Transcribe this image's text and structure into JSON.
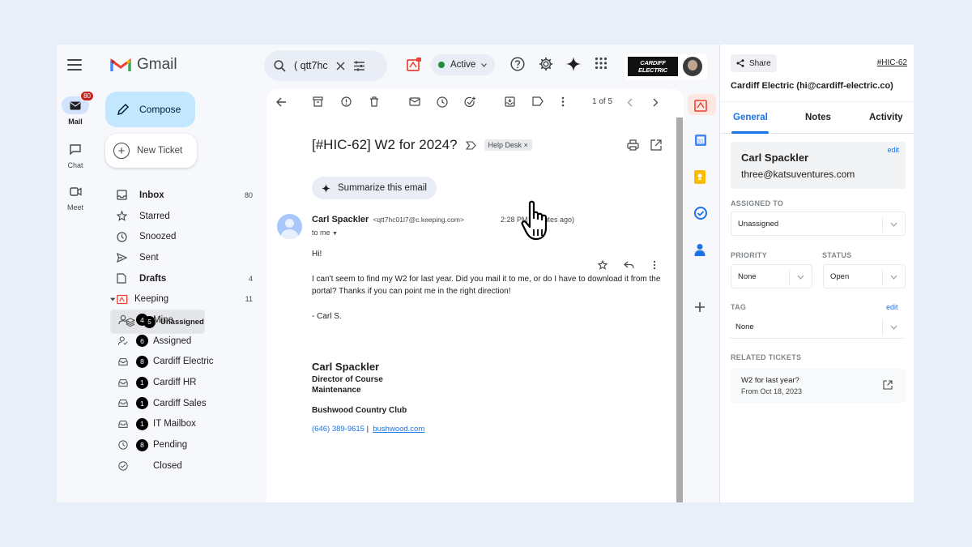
{
  "rail": {
    "items": [
      {
        "label": "Mail",
        "badge": "80"
      },
      {
        "label": "Chat"
      },
      {
        "label": "Meet"
      }
    ]
  },
  "gmail": {
    "logo_text": "Gmail",
    "compose_label": "Compose",
    "new_ticket_label": "New Ticket"
  },
  "folders": [
    {
      "name": "Inbox",
      "count": "80"
    },
    {
      "name": "Starred"
    },
    {
      "name": "Snoozed"
    },
    {
      "name": "Sent"
    },
    {
      "name": "Drafts",
      "count": "4"
    },
    {
      "name": "Keeping",
      "count": "11"
    }
  ],
  "keeping_views": [
    {
      "num": "5",
      "name": "Unassigned"
    },
    {
      "num": "4",
      "name": "Mine"
    },
    {
      "num": "6",
      "name": "Assigned"
    },
    {
      "num": "8",
      "name": "Cardiff Electric"
    },
    {
      "num": "1",
      "name": "Cardiff HR"
    },
    {
      "num": "1",
      "name": "Cardiff Sales"
    },
    {
      "num": "1",
      "name": "IT Mailbox"
    },
    {
      "num": "8",
      "name": "Pending"
    },
    {
      "name": "Closed"
    }
  ],
  "search": {
    "value": "( qtt7hc"
  },
  "status": {
    "label": "Active",
    "color": "#1e8e3e"
  },
  "brand": {
    "logo_text": "CARDIFF ELECTRIC"
  },
  "toolbar": {
    "pager": "1 of 5"
  },
  "email": {
    "subject": "[#HIC-62] W2 for 2024?",
    "label_chip": "Help Desk",
    "summarize_label": "Summarize this email",
    "sender_name": "Carl Spackler",
    "sender_addr": "<qtt7hc01l7@c.keeping.com>",
    "to_line": "to me",
    "time": "2:28 PM (minutes ago)",
    "greeting": "Hi!",
    "body": "I can't seem to find my W2 for last year. Did you mail it to me, or do I have to download it from the portal? Thanks if you can point me in the right direction!",
    "signoff": "- Carl S.",
    "sig_name": "Carl Spackler",
    "sig_title_1": "Director of Course",
    "sig_title_2": "Maintenance",
    "sig_org": "Bushwood Country Club",
    "sig_phone": "(646) 389-9615",
    "sig_sep": "|",
    "sig_link": "bushwood.com"
  },
  "panel": {
    "share_label": "Share",
    "ticket_id": "#HIC-62",
    "title": "Cardiff Electric (hi@cardiff-electric.co)",
    "tabs": [
      "General",
      "Notes",
      "Activity"
    ],
    "contact_name": "Carl Spackler",
    "contact_email": "three@katsuventures.com",
    "contact_edit": "edit",
    "assigned_to_label": "ASSIGNED TO",
    "assigned_to_value": "Unassigned",
    "priority_label": "PRIORITY",
    "priority_value": "None",
    "status_label": "STATUS",
    "status_value": "Open",
    "tag_label": "TAG",
    "tag_edit": "edit",
    "tag_value": "None",
    "related_label": "RELATED TICKETS",
    "related_title": "W2 for last year?",
    "related_date": "From Oct 18, 2023"
  },
  "colors": {
    "accent": "#1a73e8",
    "compose_bg": "#c2e7ff",
    "keeping_brand": "#ea4335"
  }
}
